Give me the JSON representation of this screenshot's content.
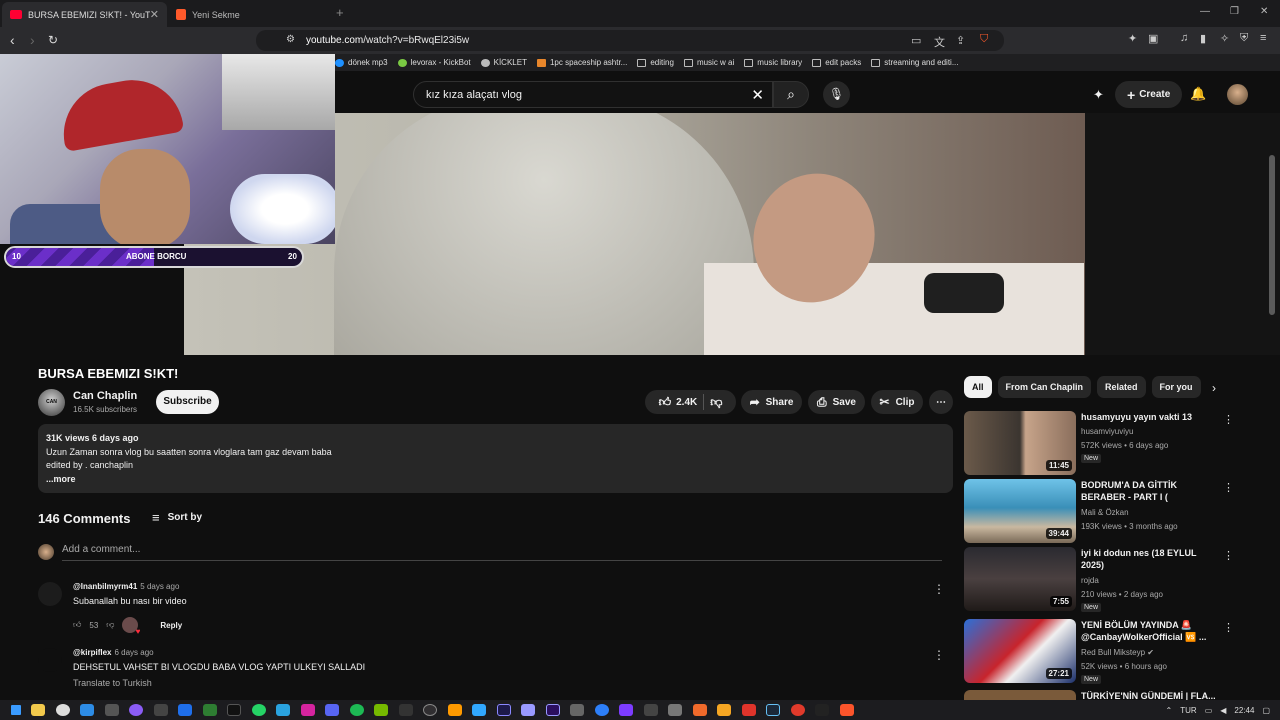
{
  "browser": {
    "tabs": [
      {
        "title": "BURSA EBEMIZI S!KT! - YouTube",
        "active": true
      },
      {
        "title": "Yeni Sekme",
        "active": false
      }
    ],
    "url_host": "youtube.com",
    "url_path": "/watch?v=bRwqEl23i5w",
    "bookmarks": [
      "dönek mp3",
      "levorax - KickBot",
      "KİCKLET",
      "1pc spaceship ashtr...",
      "editing",
      "music w ai",
      "music library",
      "edit packs",
      "streaming and editi..."
    ]
  },
  "yt_header": {
    "search_query": "kız kıza alaçatı vlog",
    "create_label": "Create"
  },
  "overlay": {
    "abone_label": "ABONE BORCU",
    "abone_current": "10",
    "abone_goal": "20",
    "abone_fraction": 0.5
  },
  "video": {
    "title": "BURSA EBEMIZI S!KT!",
    "channel": "Can Chaplin",
    "channel_avatar_text": "CAN CHAPLIN",
    "subscribers": "16.5K subscribers",
    "subscribe_label": "Subscribe",
    "likes": "2.4K",
    "share_label": "Share",
    "save_label": "Save",
    "clip_label": "Clip",
    "stats": "31K views  6 days ago",
    "desc_line1": "Uzun Zaman sonra vlog bu saatten sonra vloglara tam gaz devam baba",
    "desc_line2": "edited by . canchaplin",
    "more_label": "...more"
  },
  "comments_section": {
    "count": "146 Comments",
    "sort_label": "Sort by",
    "add_placeholder": "Add a comment...",
    "items": [
      {
        "author": "@Inanbilmyrm41",
        "time": "5 days ago",
        "text": "Subanallah bu nası bir video",
        "likes": "53",
        "reply": "Reply"
      },
      {
        "author": "@kirpiflex",
        "time": "6 days ago",
        "text": "DEHSETUL VAHSET BI VLOGDU BABA VLOG YAPTI ULKEYI SALLADI",
        "translate": "Translate to Turkish"
      }
    ]
  },
  "sidebar": {
    "chips": [
      "All",
      "From Can Chaplin",
      "Related",
      "For you"
    ],
    "recommendations": [
      {
        "title": "husamyuyu yayın vakti 13",
        "channel": "husamviyuviyu",
        "meta": "572K views • 6 days ago",
        "badge": "New",
        "duration": "11:45"
      },
      {
        "title": "BODRUM'A DA GİTTİK BERABER - PART I ( @uzielchavoofficial ...",
        "channel": "Mali & Özkan",
        "meta": "193K views • 3 months ago",
        "badge": "",
        "duration": "39:44"
      },
      {
        "title": "iyi ki dodun nes (18 EYLUL 2025)",
        "channel": "rojda",
        "meta": "210 views • 2 days ago",
        "badge": "New",
        "duration": "7:55"
      },
      {
        "title": "YENİ BÖLÜM YAYINDA 🚨 @CanbayWolkerOfficial 🆚 ...",
        "channel": "Red Bull Miksteyp ✔",
        "meta": "52K views • 6 hours ago",
        "badge": "New",
        "duration": "27:21"
      },
      {
        "title": "TÜRKİYE'NİN GÜNDEMİ | FLA...",
        "channel": "",
        "meta": "",
        "badge": "",
        "duration": ""
      }
    ]
  },
  "taskbar": {
    "lang": "TUR",
    "time": "22:44"
  }
}
